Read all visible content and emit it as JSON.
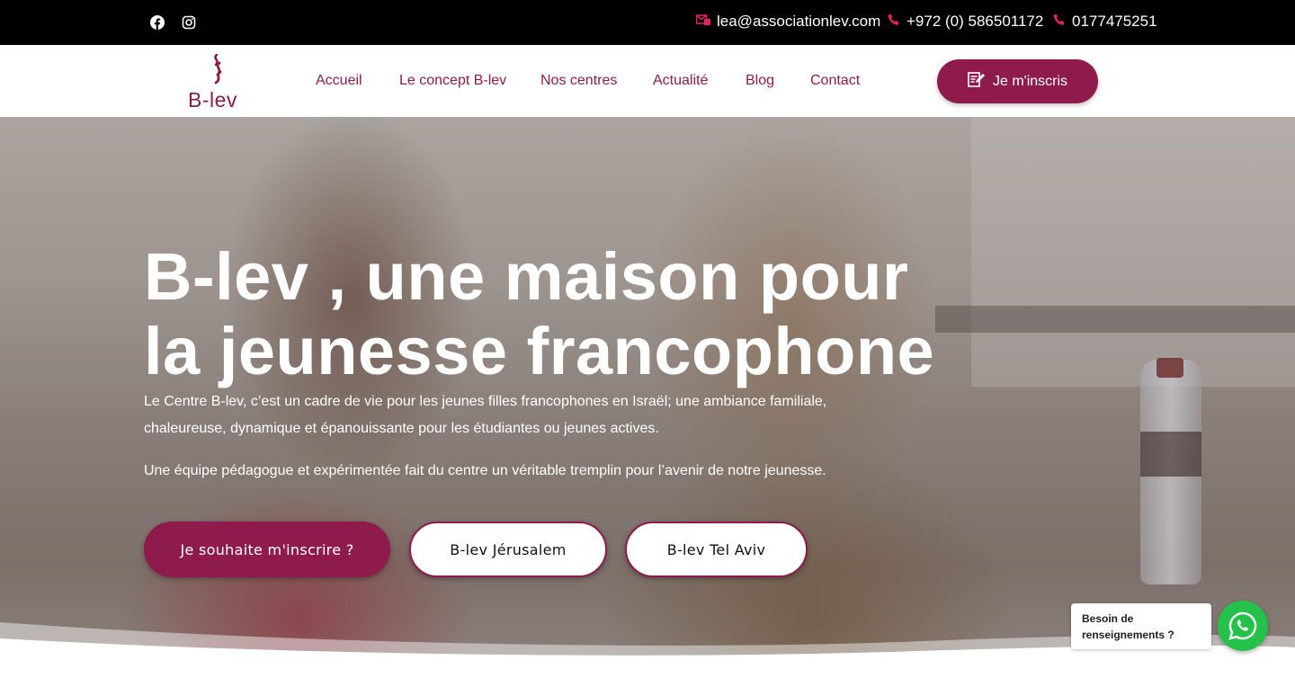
{
  "topbar": {
    "social": [
      {
        "icon": "facebook-icon"
      },
      {
        "icon": "instagram-icon"
      }
    ],
    "email": "lea@associationlev.com",
    "phone1": "+972 (0) 586501172",
    "phone2": "0177475251"
  },
  "nav": {
    "logo_text": "B-lev",
    "links": [
      "Accueil",
      "Le concept B-lev",
      "Nos centres",
      "Actualité",
      "Blog",
      "Contact"
    ],
    "cta_label": "Je m'inscris"
  },
  "hero": {
    "title_line1": "B-lev , une maison pour",
    "title_line2": "la jeunesse francophone",
    "paragraph1": "Le Centre B-lev, c’est un cadre de vie pour les jeunes filles francophones en Israël; une ambiance familiale, chaleureuse, dynamique et épanouissante pour les étudiantes ou jeunes actives.",
    "paragraph2": "Une équipe pédagogue et expérimentée fait du centre un véritable tremplin pour l’avenir de notre jeunesse.",
    "buttons": {
      "register": "Je souhaite m'inscrire ?",
      "jerusalem": "B-lev Jérusalem",
      "telaviv": "B-lev Tel Aviv"
    }
  },
  "chat": {
    "line1": "Besoin de",
    "line2": "renseignements ?"
  },
  "colors": {
    "brand": "#8e1b4b",
    "topbar": "#000000",
    "whatsapp": "#25c24b",
    "icon_red": "#e0245e"
  }
}
